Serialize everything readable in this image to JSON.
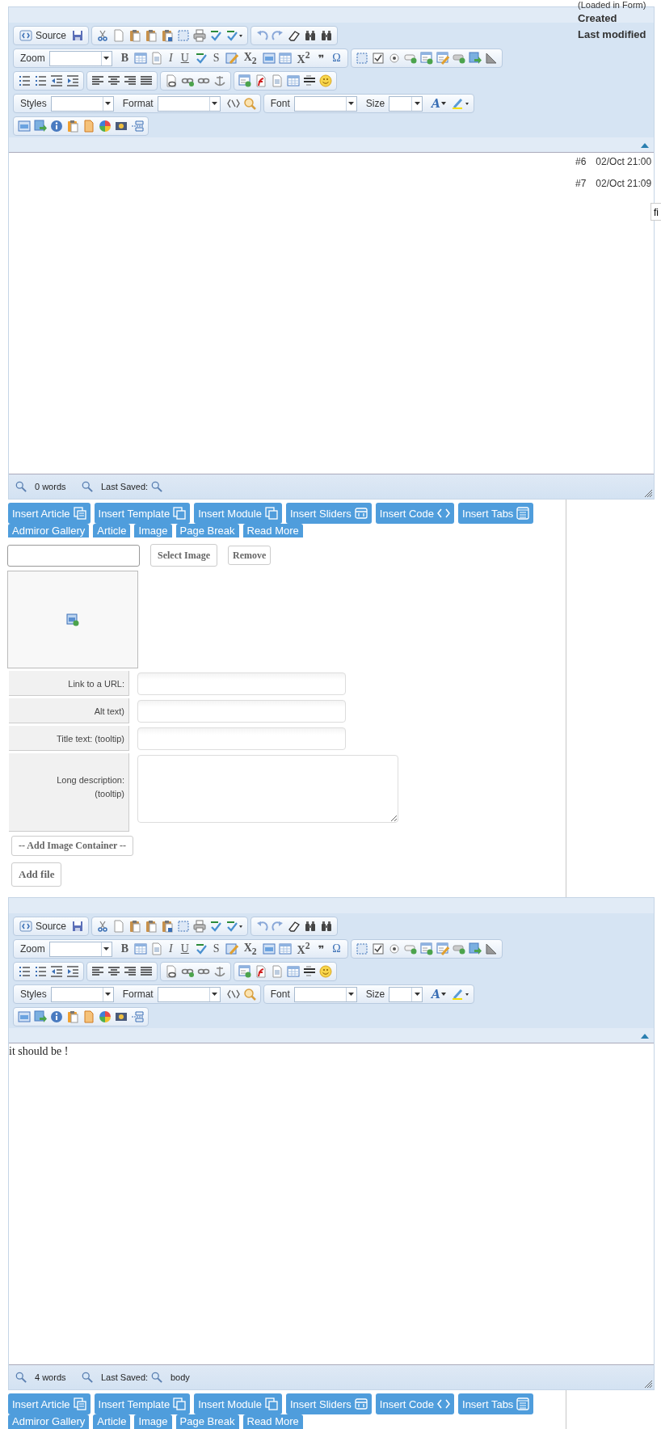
{
  "side_panel": {
    "cut_heading": "(Loaded in Form)",
    "columns": [
      "Created",
      "Last modified"
    ],
    "rows": [
      {
        "number": "#6",
        "date": "02/Oct 21:00"
      },
      {
        "number": "#7",
        "date": "02/Oct 21:09"
      }
    ],
    "tooltip": "fi"
  },
  "editors": [
    {
      "toolbar": {
        "source": "Source",
        "combos": [
          "Zoom",
          "Styles",
          "Format",
          "Font",
          "Size"
        ],
        "glyphs": [
          "B",
          "I",
          "U",
          "S",
          "X$_{2}$",
          "X$^{2}$",
          "❞",
          "Ω",
          "A"
        ]
      },
      "status": {
        "words": "0 words",
        "last_saved": "Last Saved:"
      },
      "insert_buttons": [
        "Insert Article",
        "Insert Template",
        "Insert Module",
        "Insert Sliders",
        "Insert Code",
        "Insert Tabs"
      ],
      "plugin_buttons": [
        "Admiror Gallery",
        "Article",
        "Image",
        "Page Break",
        "Read More"
      ]
    },
    {
      "toolbar": {
        "source": "Source",
        "combos": [
          "Zoom",
          "Styles",
          "Format",
          "Font",
          "Size"
        ],
        "glyphs": [
          "B",
          "I",
          "U",
          "S",
          "X$_{2}$",
          "X$^{2}$",
          "❞",
          "Ω",
          "A"
        ]
      },
      "content": "it should be !",
      "status": {
        "words": "4 words",
        "last_saved": "Last Saved:",
        "path": "body"
      },
      "insert_buttons": [
        "Insert Article",
        "Insert Template",
        "Insert Module",
        "Insert Sliders",
        "Insert Code",
        "Insert Tabs"
      ],
      "plugin_buttons": [
        "Admiror Gallery",
        "Article",
        "Image",
        "Page Break",
        "Read More"
      ]
    }
  ],
  "image_form": {
    "buttons": [
      "Select Image",
      "Remove"
    ],
    "fields": [
      {
        "label": "Link to a URL:",
        "kind": "line"
      },
      {
        "label": "Alt text)",
        "kind": "line"
      },
      {
        "label": "Title text: (tooltip)",
        "kind": "line"
      },
      {
        "label": "Long description: (tooltip)",
        "kind": "area"
      }
    ],
    "container_button": "-- Add Image Container --",
    "add_file": "Add file"
  }
}
